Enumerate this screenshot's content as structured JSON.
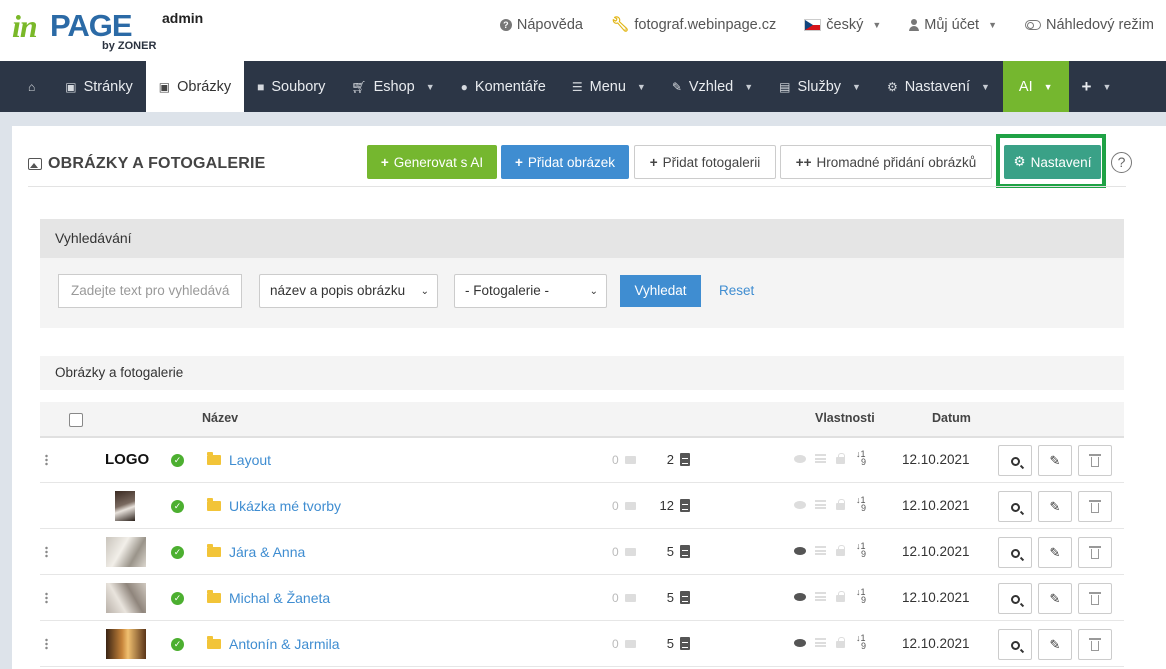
{
  "header": {
    "logo_in": "in",
    "logo_page": "PAGE",
    "logo_by": "by ZONER",
    "user_role": "admin",
    "help": "Nápověda",
    "site": "fotograf.webinpage.cz",
    "language": "český",
    "account": "Můj účet",
    "preview": "Náhledový režim"
  },
  "nav": {
    "items": [
      {
        "label": "Stránky",
        "icon": "document-icon"
      },
      {
        "label": "Obrázky",
        "icon": "image-icon",
        "active": true
      },
      {
        "label": "Soubory",
        "icon": "folder-icon"
      },
      {
        "label": "Eshop",
        "icon": "cart-icon"
      },
      {
        "label": "Komentáře",
        "icon": "comments-icon"
      },
      {
        "label": "Menu",
        "icon": "list-icon"
      },
      {
        "label": "Vzhled",
        "icon": "brush-icon"
      },
      {
        "label": "Služby",
        "icon": "services-icon"
      },
      {
        "label": "Nastavení",
        "icon": "gear-icon"
      },
      {
        "label": "AI",
        "icon": ""
      }
    ],
    "plus": "+"
  },
  "page": {
    "title": "OBRÁZKY A FOTOGALERIE",
    "buttons": {
      "generate_ai": "Generovat s AI",
      "add_image": "Přidat obrázek",
      "add_gallery": "Přidat fotogalerii",
      "bulk_add": "Hromadné přidání obrázků",
      "settings": "Nastavení"
    },
    "help": "?"
  },
  "search": {
    "heading": "Vyhledávání",
    "placeholder": "Zadejte text pro vyhledává",
    "type_selected": "název a popis obrázku",
    "gallery_selected": "- Fotogalerie -",
    "search_button": "Vyhledat",
    "reset": "Reset"
  },
  "list": {
    "heading": "Obrázky a fotogalerie",
    "columns": {
      "name": "Název",
      "properties": "Vlastnosti",
      "date": "Datum"
    },
    "rows": [
      {
        "thumb": "LOGO",
        "name": "Layout",
        "sub": "0",
        "count": "2",
        "visible": false,
        "date": "12.10.2021"
      },
      {
        "thumb": "",
        "name": "Ukázka mé tvorby",
        "sub": "0",
        "count": "12",
        "visible": false,
        "date": "12.10.2021"
      },
      {
        "thumb": "",
        "name": "Jára & Anna",
        "sub": "0",
        "count": "5",
        "visible": true,
        "date": "12.10.2021"
      },
      {
        "thumb": "",
        "name": "Michal & Žaneta",
        "sub": "0",
        "count": "5",
        "visible": true,
        "date": "12.10.2021"
      },
      {
        "thumb": "",
        "name": "Antonín & Jarmila",
        "sub": "0",
        "count": "5",
        "visible": true,
        "date": "12.10.2021"
      }
    ]
  },
  "colors": {
    "green": "#75b72f",
    "blue": "#3f8dd1",
    "teal": "#3aa187",
    "nav_bg": "#2c3646",
    "highlight": "#1fa245"
  }
}
